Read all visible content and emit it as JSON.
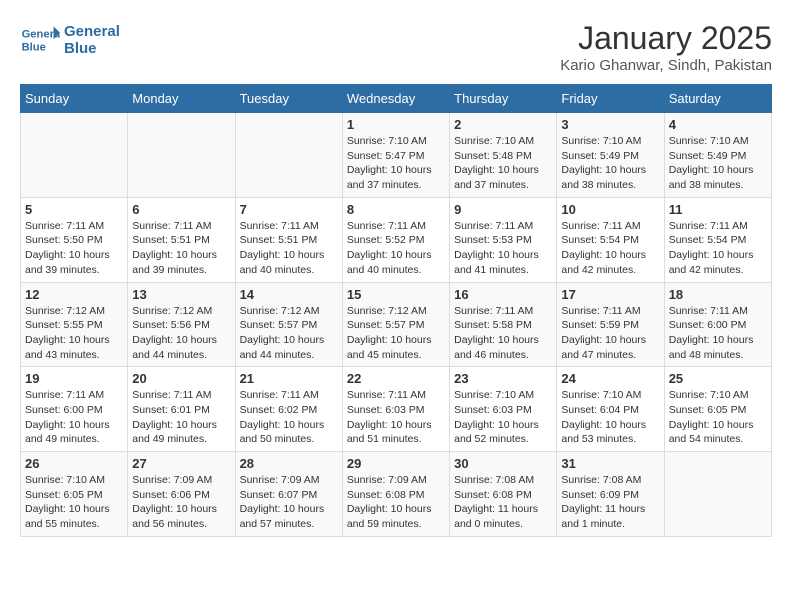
{
  "header": {
    "logo_line1": "General",
    "logo_line2": "Blue",
    "title": "January 2025",
    "subtitle": "Kario Ghanwar, Sindh, Pakistan"
  },
  "weekdays": [
    "Sunday",
    "Monday",
    "Tuesday",
    "Wednesday",
    "Thursday",
    "Friday",
    "Saturday"
  ],
  "weeks": [
    [
      {
        "day": "",
        "info": ""
      },
      {
        "day": "",
        "info": ""
      },
      {
        "day": "",
        "info": ""
      },
      {
        "day": "1",
        "info": "Sunrise: 7:10 AM\nSunset: 5:47 PM\nDaylight: 10 hours and 37 minutes."
      },
      {
        "day": "2",
        "info": "Sunrise: 7:10 AM\nSunset: 5:48 PM\nDaylight: 10 hours and 37 minutes."
      },
      {
        "day": "3",
        "info": "Sunrise: 7:10 AM\nSunset: 5:49 PM\nDaylight: 10 hours and 38 minutes."
      },
      {
        "day": "4",
        "info": "Sunrise: 7:10 AM\nSunset: 5:49 PM\nDaylight: 10 hours and 38 minutes."
      }
    ],
    [
      {
        "day": "5",
        "info": "Sunrise: 7:11 AM\nSunset: 5:50 PM\nDaylight: 10 hours and 39 minutes."
      },
      {
        "day": "6",
        "info": "Sunrise: 7:11 AM\nSunset: 5:51 PM\nDaylight: 10 hours and 39 minutes."
      },
      {
        "day": "7",
        "info": "Sunrise: 7:11 AM\nSunset: 5:51 PM\nDaylight: 10 hours and 40 minutes."
      },
      {
        "day": "8",
        "info": "Sunrise: 7:11 AM\nSunset: 5:52 PM\nDaylight: 10 hours and 40 minutes."
      },
      {
        "day": "9",
        "info": "Sunrise: 7:11 AM\nSunset: 5:53 PM\nDaylight: 10 hours and 41 minutes."
      },
      {
        "day": "10",
        "info": "Sunrise: 7:11 AM\nSunset: 5:54 PM\nDaylight: 10 hours and 42 minutes."
      },
      {
        "day": "11",
        "info": "Sunrise: 7:11 AM\nSunset: 5:54 PM\nDaylight: 10 hours and 42 minutes."
      }
    ],
    [
      {
        "day": "12",
        "info": "Sunrise: 7:12 AM\nSunset: 5:55 PM\nDaylight: 10 hours and 43 minutes."
      },
      {
        "day": "13",
        "info": "Sunrise: 7:12 AM\nSunset: 5:56 PM\nDaylight: 10 hours and 44 minutes."
      },
      {
        "day": "14",
        "info": "Sunrise: 7:12 AM\nSunset: 5:57 PM\nDaylight: 10 hours and 44 minutes."
      },
      {
        "day": "15",
        "info": "Sunrise: 7:12 AM\nSunset: 5:57 PM\nDaylight: 10 hours and 45 minutes."
      },
      {
        "day": "16",
        "info": "Sunrise: 7:11 AM\nSunset: 5:58 PM\nDaylight: 10 hours and 46 minutes."
      },
      {
        "day": "17",
        "info": "Sunrise: 7:11 AM\nSunset: 5:59 PM\nDaylight: 10 hours and 47 minutes."
      },
      {
        "day": "18",
        "info": "Sunrise: 7:11 AM\nSunset: 6:00 PM\nDaylight: 10 hours and 48 minutes."
      }
    ],
    [
      {
        "day": "19",
        "info": "Sunrise: 7:11 AM\nSunset: 6:00 PM\nDaylight: 10 hours and 49 minutes."
      },
      {
        "day": "20",
        "info": "Sunrise: 7:11 AM\nSunset: 6:01 PM\nDaylight: 10 hours and 49 minutes."
      },
      {
        "day": "21",
        "info": "Sunrise: 7:11 AM\nSunset: 6:02 PM\nDaylight: 10 hours and 50 minutes."
      },
      {
        "day": "22",
        "info": "Sunrise: 7:11 AM\nSunset: 6:03 PM\nDaylight: 10 hours and 51 minutes."
      },
      {
        "day": "23",
        "info": "Sunrise: 7:10 AM\nSunset: 6:03 PM\nDaylight: 10 hours and 52 minutes."
      },
      {
        "day": "24",
        "info": "Sunrise: 7:10 AM\nSunset: 6:04 PM\nDaylight: 10 hours and 53 minutes."
      },
      {
        "day": "25",
        "info": "Sunrise: 7:10 AM\nSunset: 6:05 PM\nDaylight: 10 hours and 54 minutes."
      }
    ],
    [
      {
        "day": "26",
        "info": "Sunrise: 7:10 AM\nSunset: 6:05 PM\nDaylight: 10 hours and 55 minutes."
      },
      {
        "day": "27",
        "info": "Sunrise: 7:09 AM\nSunset: 6:06 PM\nDaylight: 10 hours and 56 minutes."
      },
      {
        "day": "28",
        "info": "Sunrise: 7:09 AM\nSunset: 6:07 PM\nDaylight: 10 hours and 57 minutes."
      },
      {
        "day": "29",
        "info": "Sunrise: 7:09 AM\nSunset: 6:08 PM\nDaylight: 10 hours and 59 minutes."
      },
      {
        "day": "30",
        "info": "Sunrise: 7:08 AM\nSunset: 6:08 PM\nDaylight: 11 hours and 0 minutes."
      },
      {
        "day": "31",
        "info": "Sunrise: 7:08 AM\nSunset: 6:09 PM\nDaylight: 11 hours and 1 minute."
      },
      {
        "day": "",
        "info": ""
      }
    ]
  ]
}
